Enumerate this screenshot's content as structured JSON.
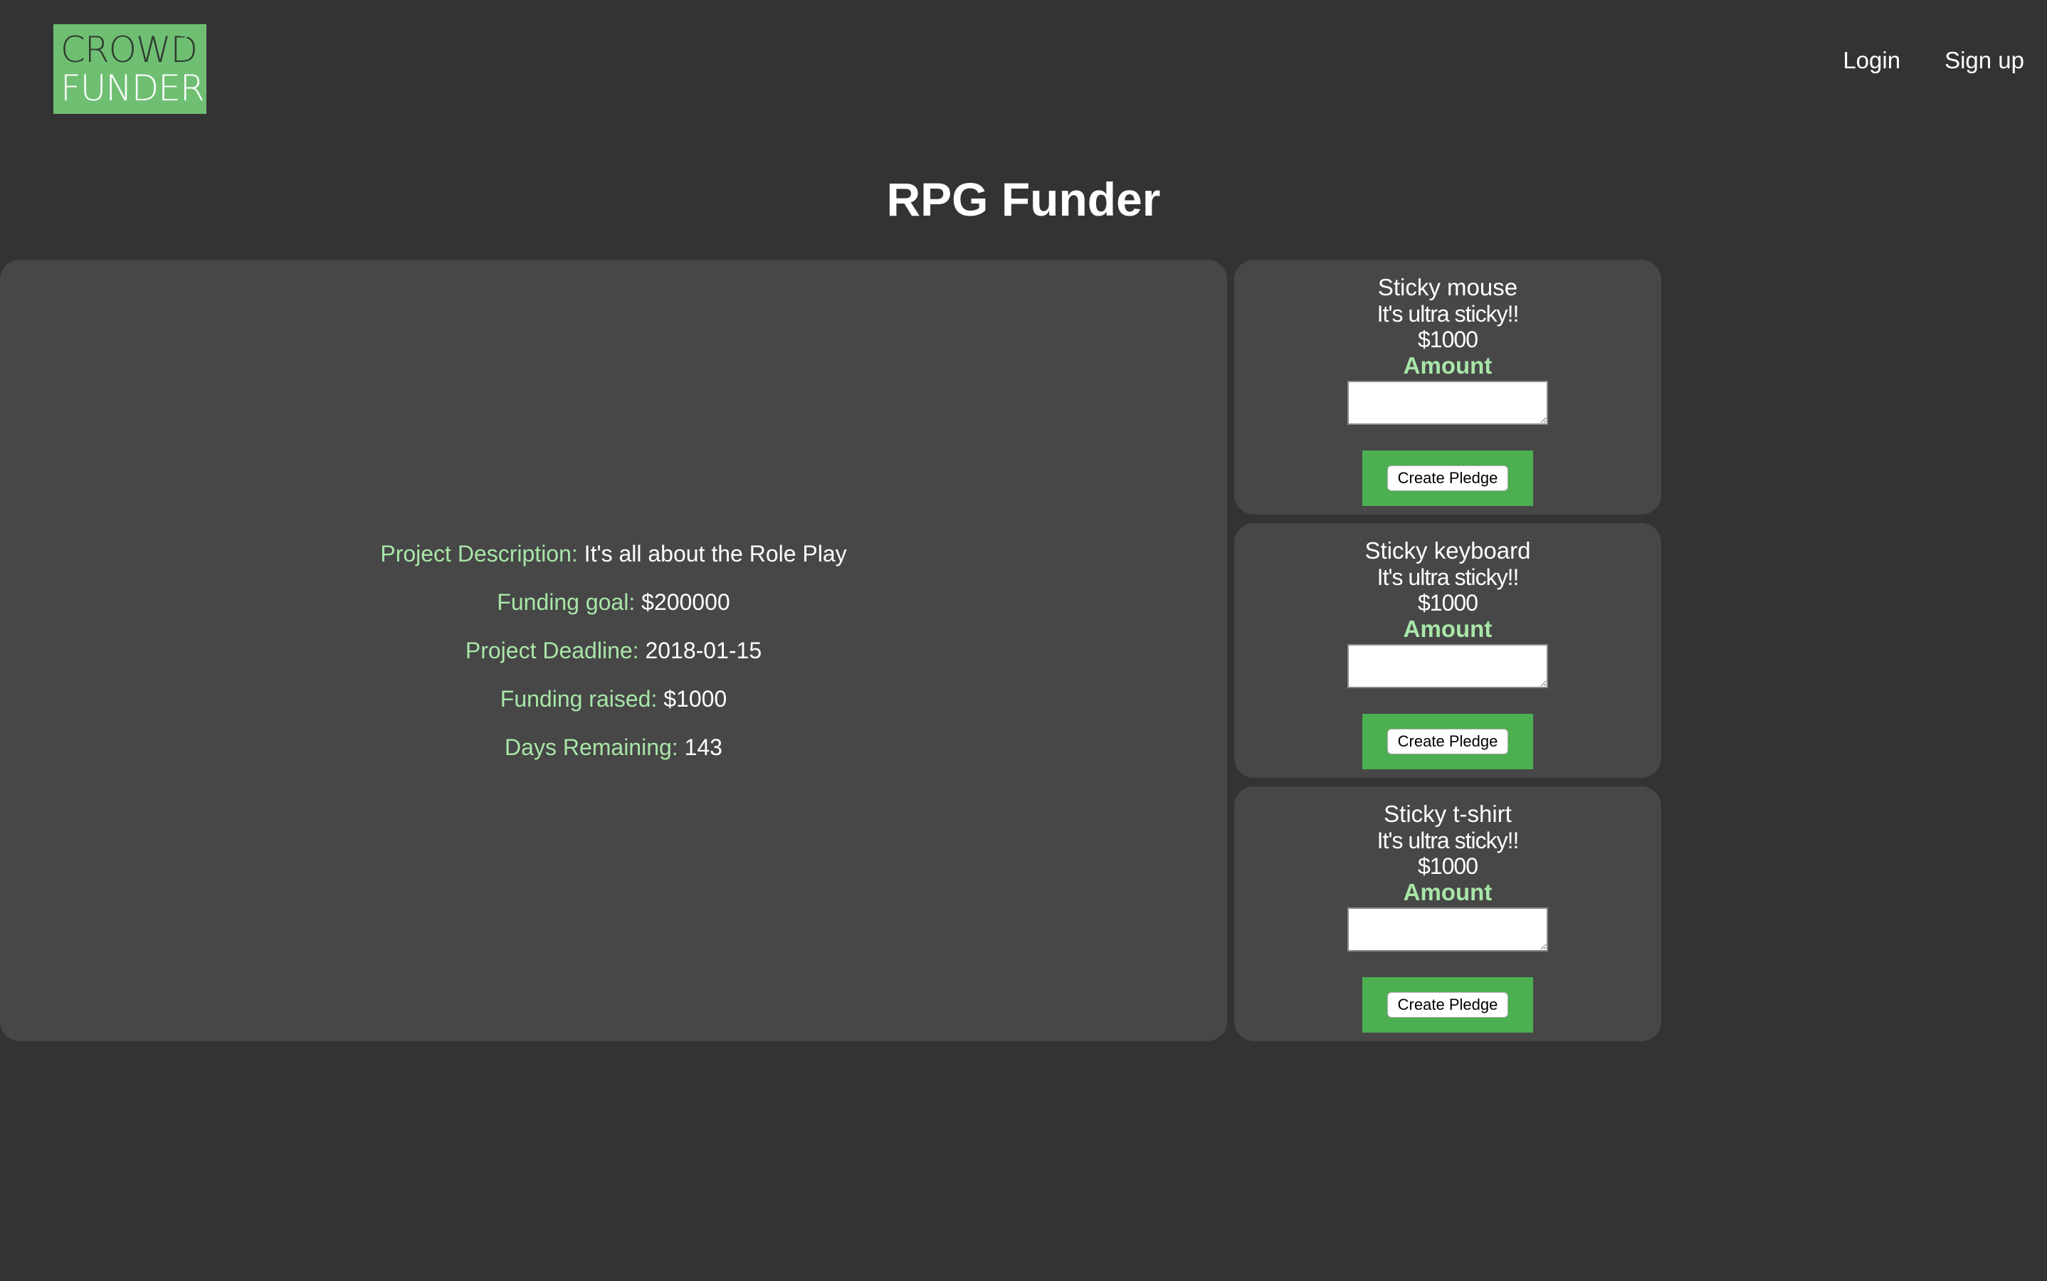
{
  "logo": {
    "line1": "CROWD",
    "line2": "FUNDER",
    "icon": "sprout-icon"
  },
  "nav": {
    "login": "Login",
    "signup": "Sign up"
  },
  "project": {
    "title": "RPG Funder",
    "details": [
      {
        "label": "Project Description:",
        "value": "It's all about the Role Play"
      },
      {
        "label": "Funding goal:",
        "value": "$200000"
      },
      {
        "label": "Project Deadline:",
        "value": "2018-01-15"
      },
      {
        "label": "Funding raised:",
        "value": "$1000"
      },
      {
        "label": "Days Remaining:",
        "value": "143"
      }
    ]
  },
  "rewards": [
    {
      "name": "Sticky mouse",
      "description": "It's ultra sticky!!",
      "price": "$1000",
      "amount_label": "Amount",
      "amount_value": "",
      "button": "Create Pledge"
    },
    {
      "name": "Sticky keyboard",
      "description": "It's ultra sticky!!",
      "price": "$1000",
      "amount_label": "Amount",
      "amount_value": "",
      "button": "Create Pledge"
    },
    {
      "name": "Sticky t-shirt",
      "description": "It's ultra sticky!!",
      "price": "$1000",
      "amount_label": "Amount",
      "amount_value": "",
      "button": "Create Pledge"
    }
  ],
  "colors": {
    "background": "#333333",
    "panel": "#474747",
    "accent_green": "#4caf50",
    "label_green": "#a8e6a8",
    "logo_green": "#6fbf73"
  }
}
